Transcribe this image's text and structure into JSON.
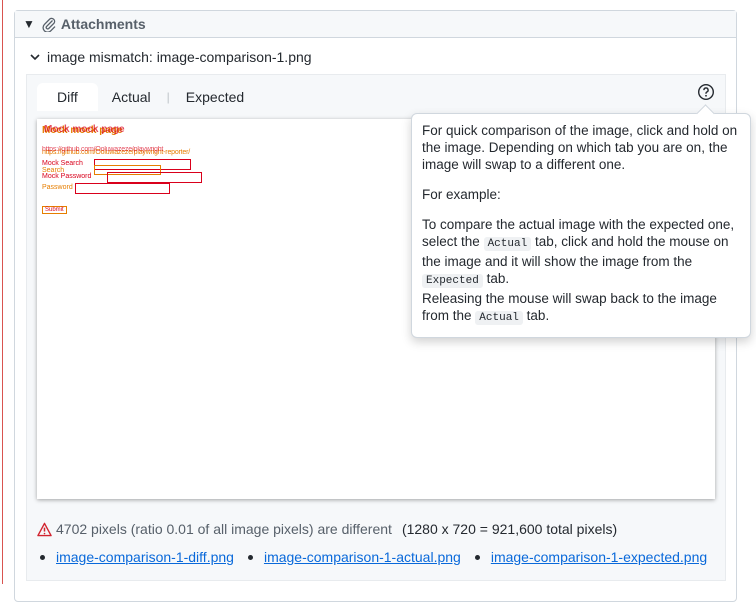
{
  "attachments": {
    "header_label": "Attachments",
    "item_title": "image mismatch: image-comparison-1.png"
  },
  "tabs": [
    {
      "label": "Diff",
      "active": true
    },
    {
      "label": "Actual",
      "active": false
    },
    {
      "label": "Expected",
      "active": false
    }
  ],
  "diff_image": {
    "title_a": "Mock mock page",
    "title_b": "Mock mock page",
    "url_a": "https://github.com/Ooluwazeze/playwright-reporter/",
    "url_b": "https://github.com/Ooluwazeze/playwright",
    "field_1": "Mock Search",
    "field_1b": "Search",
    "field_2": "Mock Password",
    "field_3": "Password",
    "submit": "Submit"
  },
  "tooltip": {
    "p1": "For quick comparison of the image, click and hold on the image. Depending on which tab you are on, the image will swap to a different one.",
    "p2": "For example:",
    "p3_a": "To compare the actual image with the expected one, select the",
    "p3_code1": "Actual",
    "p3_b": "tab, click and hold the mouse on the image and it will show the image from the",
    "p3_code2": "Expected",
    "p3_c": "tab.",
    "p4_a": "Releasing the mouse will swap back to the image from the",
    "p4_code": "Actual",
    "p4_b": "tab."
  },
  "stats": {
    "diff_text": "4702 pixels (ratio 0.01 of all image pixels) are different",
    "total_text": "(1280 x 720 = 921,600 total pixels)"
  },
  "links": [
    "image-comparison-1-diff.png",
    "image-comparison-1-actual.png",
    "image-comparison-1-expected.png"
  ],
  "colors": {
    "link": "#0969da",
    "warning": "#d1242f",
    "diff_red": "#d9001b",
    "diff_orange": "#e67e00"
  },
  "icons": [
    "caret-down-icon",
    "paperclip-icon",
    "chevron-down-icon",
    "help-circle-icon",
    "warning-icon"
  ]
}
